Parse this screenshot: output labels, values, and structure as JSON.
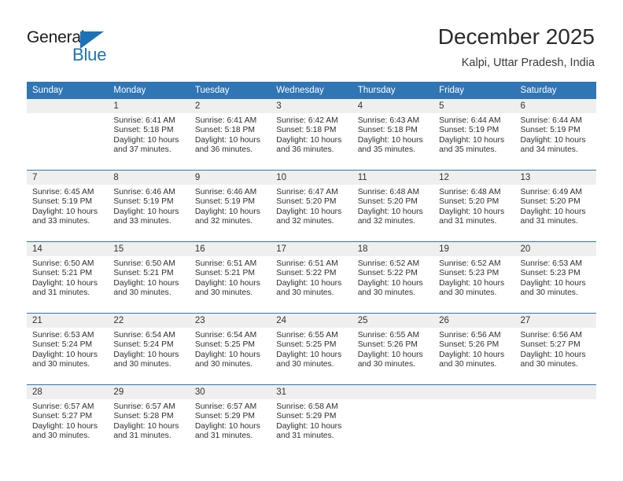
{
  "brand": {
    "name_primary": "General",
    "name_secondary": "Blue",
    "accent_color": "#1c72b8"
  },
  "header": {
    "title": "December 2025",
    "subtitle": "Kalpi, Uttar Pradesh, India"
  },
  "calendar": {
    "header_bg": "#3075b4",
    "daynum_bg": "#efeff0",
    "columns": [
      "Sunday",
      "Monday",
      "Tuesday",
      "Wednesday",
      "Thursday",
      "Friday",
      "Saturday"
    ],
    "weeks": [
      [
        {
          "day": "",
          "sunrise": "",
          "sunset": "",
          "daylight_line1": "",
          "daylight_line2": ""
        },
        {
          "day": "1",
          "sunrise": "Sunrise: 6:41 AM",
          "sunset": "Sunset: 5:18 PM",
          "daylight_line1": "Daylight: 10 hours",
          "daylight_line2": "and 37 minutes."
        },
        {
          "day": "2",
          "sunrise": "Sunrise: 6:41 AM",
          "sunset": "Sunset: 5:18 PM",
          "daylight_line1": "Daylight: 10 hours",
          "daylight_line2": "and 36 minutes."
        },
        {
          "day": "3",
          "sunrise": "Sunrise: 6:42 AM",
          "sunset": "Sunset: 5:18 PM",
          "daylight_line1": "Daylight: 10 hours",
          "daylight_line2": "and 36 minutes."
        },
        {
          "day": "4",
          "sunrise": "Sunrise: 6:43 AM",
          "sunset": "Sunset: 5:18 PM",
          "daylight_line1": "Daylight: 10 hours",
          "daylight_line2": "and 35 minutes."
        },
        {
          "day": "5",
          "sunrise": "Sunrise: 6:44 AM",
          "sunset": "Sunset: 5:19 PM",
          "daylight_line1": "Daylight: 10 hours",
          "daylight_line2": "and 35 minutes."
        },
        {
          "day": "6",
          "sunrise": "Sunrise: 6:44 AM",
          "sunset": "Sunset: 5:19 PM",
          "daylight_line1": "Daylight: 10 hours",
          "daylight_line2": "and 34 minutes."
        }
      ],
      [
        {
          "day": "7",
          "sunrise": "Sunrise: 6:45 AM",
          "sunset": "Sunset: 5:19 PM",
          "daylight_line1": "Daylight: 10 hours",
          "daylight_line2": "and 33 minutes."
        },
        {
          "day": "8",
          "sunrise": "Sunrise: 6:46 AM",
          "sunset": "Sunset: 5:19 PM",
          "daylight_line1": "Daylight: 10 hours",
          "daylight_line2": "and 33 minutes."
        },
        {
          "day": "9",
          "sunrise": "Sunrise: 6:46 AM",
          "sunset": "Sunset: 5:19 PM",
          "daylight_line1": "Daylight: 10 hours",
          "daylight_line2": "and 32 minutes."
        },
        {
          "day": "10",
          "sunrise": "Sunrise: 6:47 AM",
          "sunset": "Sunset: 5:20 PM",
          "daylight_line1": "Daylight: 10 hours",
          "daylight_line2": "and 32 minutes."
        },
        {
          "day": "11",
          "sunrise": "Sunrise: 6:48 AM",
          "sunset": "Sunset: 5:20 PM",
          "daylight_line1": "Daylight: 10 hours",
          "daylight_line2": "and 32 minutes."
        },
        {
          "day": "12",
          "sunrise": "Sunrise: 6:48 AM",
          "sunset": "Sunset: 5:20 PM",
          "daylight_line1": "Daylight: 10 hours",
          "daylight_line2": "and 31 minutes."
        },
        {
          "day": "13",
          "sunrise": "Sunrise: 6:49 AM",
          "sunset": "Sunset: 5:20 PM",
          "daylight_line1": "Daylight: 10 hours",
          "daylight_line2": "and 31 minutes."
        }
      ],
      [
        {
          "day": "14",
          "sunrise": "Sunrise: 6:50 AM",
          "sunset": "Sunset: 5:21 PM",
          "daylight_line1": "Daylight: 10 hours",
          "daylight_line2": "and 31 minutes."
        },
        {
          "day": "15",
          "sunrise": "Sunrise: 6:50 AM",
          "sunset": "Sunset: 5:21 PM",
          "daylight_line1": "Daylight: 10 hours",
          "daylight_line2": "and 30 minutes."
        },
        {
          "day": "16",
          "sunrise": "Sunrise: 6:51 AM",
          "sunset": "Sunset: 5:21 PM",
          "daylight_line1": "Daylight: 10 hours",
          "daylight_line2": "and 30 minutes."
        },
        {
          "day": "17",
          "sunrise": "Sunrise: 6:51 AM",
          "sunset": "Sunset: 5:22 PM",
          "daylight_line1": "Daylight: 10 hours",
          "daylight_line2": "and 30 minutes."
        },
        {
          "day": "18",
          "sunrise": "Sunrise: 6:52 AM",
          "sunset": "Sunset: 5:22 PM",
          "daylight_line1": "Daylight: 10 hours",
          "daylight_line2": "and 30 minutes."
        },
        {
          "day": "19",
          "sunrise": "Sunrise: 6:52 AM",
          "sunset": "Sunset: 5:23 PM",
          "daylight_line1": "Daylight: 10 hours",
          "daylight_line2": "and 30 minutes."
        },
        {
          "day": "20",
          "sunrise": "Sunrise: 6:53 AM",
          "sunset": "Sunset: 5:23 PM",
          "daylight_line1": "Daylight: 10 hours",
          "daylight_line2": "and 30 minutes."
        }
      ],
      [
        {
          "day": "21",
          "sunrise": "Sunrise: 6:53 AM",
          "sunset": "Sunset: 5:24 PM",
          "daylight_line1": "Daylight: 10 hours",
          "daylight_line2": "and 30 minutes."
        },
        {
          "day": "22",
          "sunrise": "Sunrise: 6:54 AM",
          "sunset": "Sunset: 5:24 PM",
          "daylight_line1": "Daylight: 10 hours",
          "daylight_line2": "and 30 minutes."
        },
        {
          "day": "23",
          "sunrise": "Sunrise: 6:54 AM",
          "sunset": "Sunset: 5:25 PM",
          "daylight_line1": "Daylight: 10 hours",
          "daylight_line2": "and 30 minutes."
        },
        {
          "day": "24",
          "sunrise": "Sunrise: 6:55 AM",
          "sunset": "Sunset: 5:25 PM",
          "daylight_line1": "Daylight: 10 hours",
          "daylight_line2": "and 30 minutes."
        },
        {
          "day": "25",
          "sunrise": "Sunrise: 6:55 AM",
          "sunset": "Sunset: 5:26 PM",
          "daylight_line1": "Daylight: 10 hours",
          "daylight_line2": "and 30 minutes."
        },
        {
          "day": "26",
          "sunrise": "Sunrise: 6:56 AM",
          "sunset": "Sunset: 5:26 PM",
          "daylight_line1": "Daylight: 10 hours",
          "daylight_line2": "and 30 minutes."
        },
        {
          "day": "27",
          "sunrise": "Sunrise: 6:56 AM",
          "sunset": "Sunset: 5:27 PM",
          "daylight_line1": "Daylight: 10 hours",
          "daylight_line2": "and 30 minutes."
        }
      ],
      [
        {
          "day": "28",
          "sunrise": "Sunrise: 6:57 AM",
          "sunset": "Sunset: 5:27 PM",
          "daylight_line1": "Daylight: 10 hours",
          "daylight_line2": "and 30 minutes."
        },
        {
          "day": "29",
          "sunrise": "Sunrise: 6:57 AM",
          "sunset": "Sunset: 5:28 PM",
          "daylight_line1": "Daylight: 10 hours",
          "daylight_line2": "and 31 minutes."
        },
        {
          "day": "30",
          "sunrise": "Sunrise: 6:57 AM",
          "sunset": "Sunset: 5:29 PM",
          "daylight_line1": "Daylight: 10 hours",
          "daylight_line2": "and 31 minutes."
        },
        {
          "day": "31",
          "sunrise": "Sunrise: 6:58 AM",
          "sunset": "Sunset: 5:29 PM",
          "daylight_line1": "Daylight: 10 hours",
          "daylight_line2": "and 31 minutes."
        },
        {
          "day": "",
          "sunrise": "",
          "sunset": "",
          "daylight_line1": "",
          "daylight_line2": ""
        },
        {
          "day": "",
          "sunrise": "",
          "sunset": "",
          "daylight_line1": "",
          "daylight_line2": ""
        },
        {
          "day": "",
          "sunrise": "",
          "sunset": "",
          "daylight_line1": "",
          "daylight_line2": ""
        }
      ]
    ]
  }
}
